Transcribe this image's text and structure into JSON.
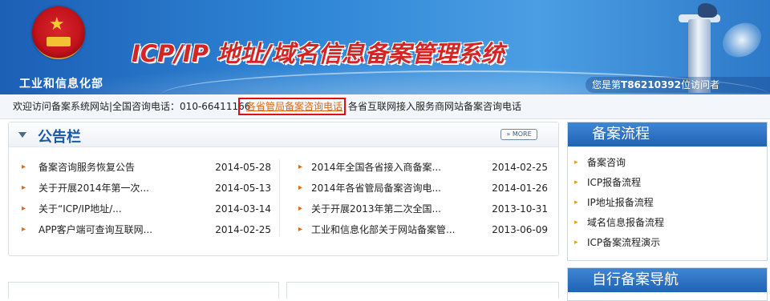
{
  "header": {
    "ministry": "工业和信息化部",
    "system_title": "ICP/IP 地址/域名信息备案管理系统",
    "visitor_prefix": "您是第",
    "visitor_count": "T86210392",
    "visitor_suffix": "位访问者"
  },
  "infobar": {
    "welcome": "欢迎访问备案系统网站|全国咨询电话：010-66411166",
    "link_provincial": "各省管局备案咨询电话",
    "link_isp": "各省互联网接入服务商网站备案咨询电话"
  },
  "notice": {
    "title": "公告栏",
    "more": "» MORE",
    "left": [
      {
        "text": "备案咨询服务恢复公告",
        "date": "2014-05-28"
      },
      {
        "text": "关于开展2014年第一次...",
        "date": "2014-05-13"
      },
      {
        "text": "关于“ICP/IP地址/...",
        "date": "2014-03-14"
      },
      {
        "text": "APP客户端可查询互联网...",
        "date": "2014-02-25"
      }
    ],
    "right": [
      {
        "text": "2014年全国各省接入商备案...",
        "date": "2014-02-25"
      },
      {
        "text": "2014年各省管局备案咨询电...",
        "date": "2014-01-26"
      },
      {
        "text": "关于开展2013年第二次全国...",
        "date": "2013-10-31"
      },
      {
        "text": "工业和信息化部关于网站备案管...",
        "date": "2013-06-09"
      }
    ]
  },
  "flow": {
    "title": "备案流程",
    "items": [
      "备案咨询",
      "ICP报备流程",
      "IP地址报备流程",
      "域名信息报备流程",
      "ICP备案流程演示"
    ]
  },
  "self_nav": {
    "title": "自行备案导航"
  },
  "colors": {
    "accent_red": "#d42525",
    "link_orange": "#e06a14",
    "panel_blue": "#1f63b5"
  }
}
